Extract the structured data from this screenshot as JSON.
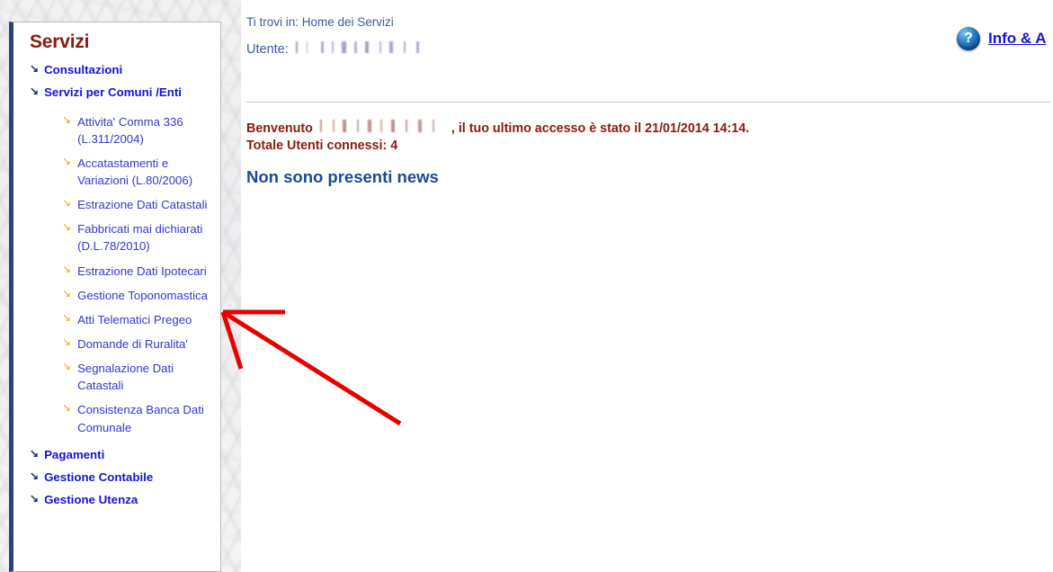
{
  "sidebar": {
    "title": "Servizi",
    "groups": [
      {
        "label": "Consultazioni",
        "bullet": "↘",
        "children": []
      },
      {
        "label": "Servizi per Comuni /Enti",
        "bullet": "↘",
        "children": [
          {
            "label": "Attivita' Comma 336 (L.311/2004)",
            "bullet": "↘"
          },
          {
            "label": "Accatastamenti e Variazioni (L.80/2006)",
            "bullet": "↘"
          },
          {
            "label": "Estrazione Dati Catastali",
            "bullet": "↘"
          },
          {
            "label": "Fabbricati mai dichiarati (D.L.78/2010)",
            "bullet": "↘"
          },
          {
            "label": "Estrazione Dati Ipotecari",
            "bullet": "↘"
          },
          {
            "label": "Gestione Toponomastica",
            "bullet": "↘"
          },
          {
            "label": "Atti Telematici Pregeo",
            "bullet": "↘"
          },
          {
            "label": "Domande di Ruralita'",
            "bullet": "↘"
          },
          {
            "label": "Segnalazione Dati Catastali",
            "bullet": "↘"
          },
          {
            "label": "Consistenza Banca Dati Comunale",
            "bullet": "↘"
          }
        ]
      },
      {
        "label": "Pagamenti",
        "bullet": "↘",
        "children": []
      },
      {
        "label": "Gestione Contabile",
        "bullet": "↘",
        "children": []
      },
      {
        "label": "Gestione Utenza",
        "bullet": "↘",
        "children": []
      }
    ]
  },
  "main": {
    "breadcrumb": "Ti trovi in: Home dei Servizi",
    "user_label": "Utente:",
    "user_value": "",
    "welcome_prefix": "Benvenuto",
    "welcome_suffix": ", il tuo ultimo accesso è stato il 21/01/2014 14:14.",
    "connected_users": "Totale  Utenti connessi: 4",
    "news_message": "Non sono presenti news"
  },
  "info_assist": {
    "icon_glyph": "?",
    "label": "Info & A"
  },
  "annotation": {
    "color": "#e60000"
  },
  "colors": {
    "title_red": "#8b1a10",
    "link_blue": "#1414d2",
    "sublink_blue": "#3636cf",
    "bullet_navy": "#20228c",
    "bullet_gold": "#f0a30a",
    "breadcrumb_blue": "#3a5c9e",
    "news_blue": "#1b4a92",
    "sidebar_edge": "#2e3f82",
    "arrow_red": "#e60000"
  }
}
